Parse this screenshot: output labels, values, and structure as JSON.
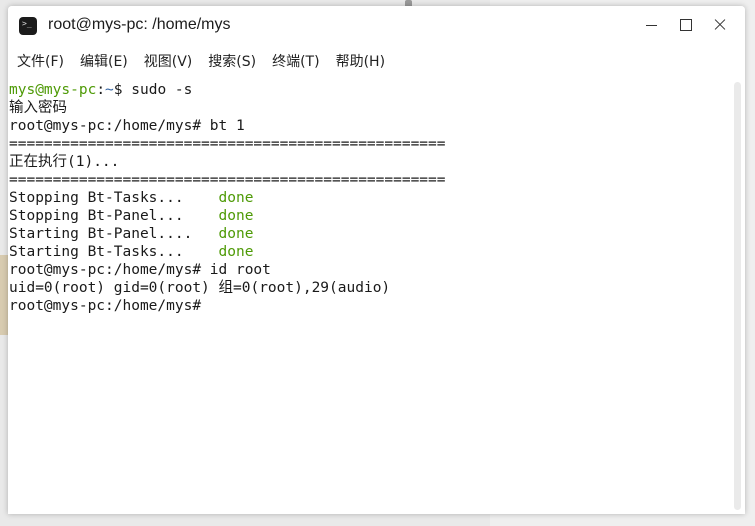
{
  "window": {
    "title": "root@mys-pc: /home/mys"
  },
  "menu": {
    "items": [
      "文件(F)",
      "编辑(E)",
      "视图(V)",
      "搜索(S)",
      "终端(T)",
      "帮助(H)"
    ]
  },
  "terminal": {
    "prompt_user": "mys@mys-pc",
    "prompt_sep": ":",
    "prompt_path": "~",
    "prompt_end": "$ ",
    "cmd1": "sudo -s",
    "line2": "输入密码",
    "line3": "root@mys-pc:/home/mys# bt 1",
    "line4": "==================================================",
    "line5": "正在执行(1)...",
    "line6": "==================================================",
    "task1": "Stopping Bt-Tasks...    ",
    "task1_status": "done",
    "task2": "Stopping Bt-Panel...    ",
    "task2_status": "done",
    "task3": "Starting Bt-Panel....   ",
    "task3_status": "done",
    "task4": "Starting Bt-Tasks...    ",
    "task4_status": "done",
    "line11": "root@mys-pc:/home/mys# id root",
    "line12": "uid=0(root) gid=0(root) 组=0(root),29(audio)",
    "line13": "root@mys-pc:/home/mys# "
  },
  "colors": {
    "prompt_user": "#4e9a06",
    "prompt_path": "#3465a4",
    "status_done": "#4e9a06"
  },
  "icons": [
    "terminal-app-icon",
    "minimize-icon",
    "maximize-icon",
    "close-icon"
  ]
}
